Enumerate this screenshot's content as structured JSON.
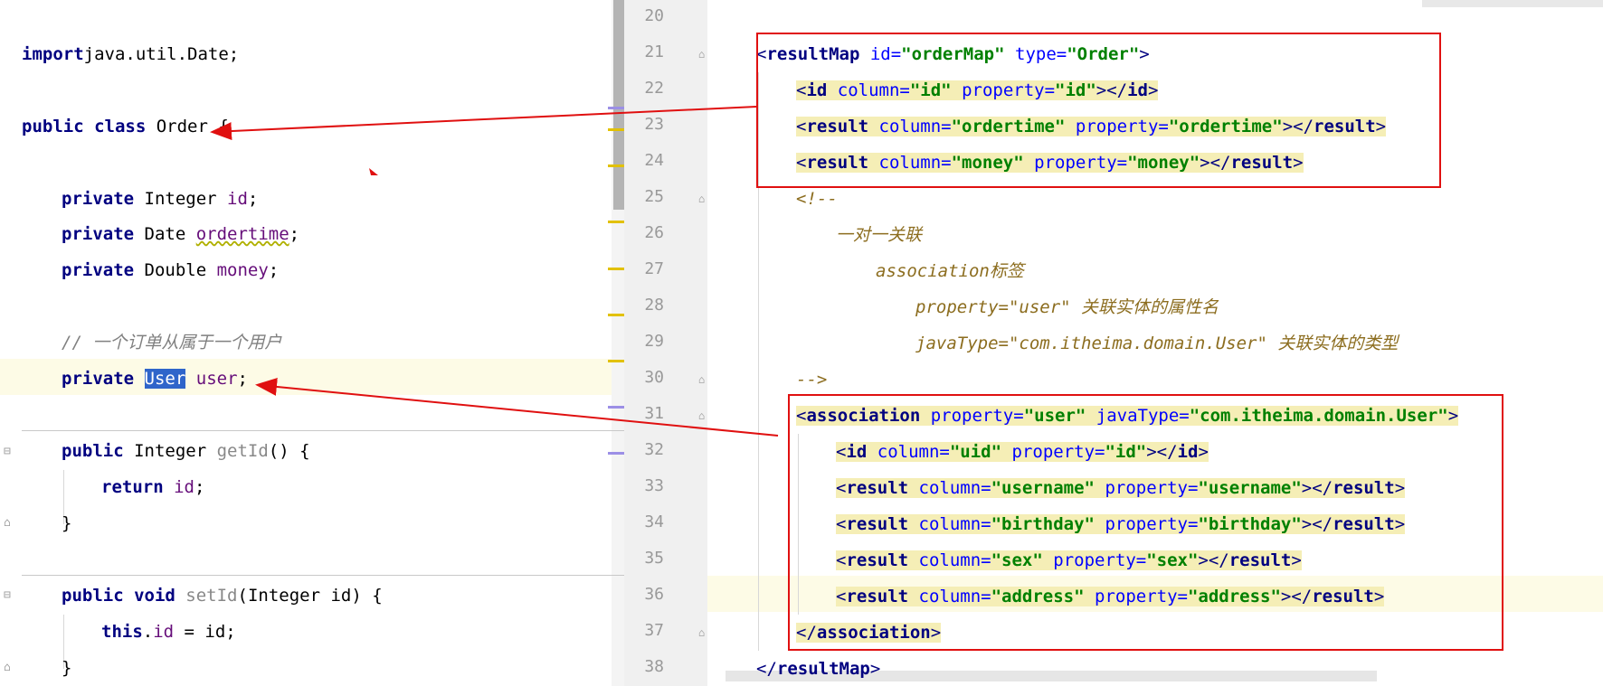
{
  "java_editor": {
    "lines": [
      {
        "parts": [
          [
            "kw",
            "import"
          ],
          [
            "",
            "java.util.Date;"
          ]
        ]
      },
      {
        "parts": [
          [
            "kw",
            "public class"
          ],
          [
            "",
            " Order {"
          ]
        ]
      },
      {
        "parts": [
          [
            "kw",
            "private"
          ],
          [
            "",
            " Integer "
          ],
          [
            "fld",
            "id"
          ],
          [
            "",
            ";"
          ]
        ]
      },
      {
        "parts": [
          [
            "kw",
            "private"
          ],
          [
            "",
            " Date "
          ],
          [
            "fldu",
            "ordertime"
          ],
          [
            "",
            ";"
          ]
        ]
      },
      {
        "parts": [
          [
            "kw",
            "private"
          ],
          [
            "",
            " Double "
          ],
          [
            "fld",
            "money"
          ],
          [
            "",
            ";"
          ]
        ]
      },
      {
        "parts": [
          [
            "cm",
            "// 一个订单从属于一个用户"
          ]
        ]
      },
      {
        "parts": [
          [
            "kw",
            "private"
          ],
          [
            "",
            " "
          ],
          [
            "sel",
            "User"
          ],
          [
            "",
            " "
          ],
          [
            "fld",
            "user"
          ],
          [
            "",
            ";"
          ]
        ]
      },
      {
        "parts": [
          [
            "kw",
            "public"
          ],
          [
            "",
            " Integer "
          ],
          [
            "mth",
            "getId"
          ],
          [
            "",
            "() {"
          ]
        ]
      },
      {
        "parts": [
          [
            "kw",
            "return"
          ],
          [
            "",
            " "
          ],
          [
            "fld",
            "id"
          ],
          [
            "",
            ";"
          ]
        ]
      },
      {
        "parts": [
          [
            "",
            "}"
          ]
        ]
      },
      {
        "parts": [
          [
            "kw",
            "public void"
          ],
          [
            "",
            " "
          ],
          [
            "mth",
            "setId"
          ],
          [
            "",
            "(Integer id) {"
          ]
        ]
      },
      {
        "parts": [
          [
            "kw",
            "this"
          ],
          [
            "",
            "."
          ],
          [
            "fld",
            "id"
          ],
          [
            "",
            " = id;"
          ]
        ]
      },
      {
        "parts": [
          [
            "",
            "}"
          ]
        ]
      }
    ]
  },
  "xml_editor": {
    "line_numbers": [
      "20",
      "21",
      "22",
      "23",
      "24",
      "25",
      "26",
      "27",
      "28",
      "29",
      "30",
      "31",
      "32",
      "33",
      "34",
      "35",
      "36",
      "37",
      "38"
    ],
    "lines": [
      {
        "parts": []
      },
      {
        "parts": [
          [
            "tag",
            "<"
          ],
          [
            "kw2",
            "resultMap"
          ],
          [
            "at",
            " id="
          ],
          [
            "sv",
            "\"orderMap\""
          ],
          [
            "at",
            " type="
          ],
          [
            "sv",
            "\"Order\""
          ],
          [
            "tag",
            ">"
          ]
        ]
      },
      {
        "parts": [
          [
            "tag",
            "<"
          ],
          [
            "kw2",
            "id"
          ],
          [
            "at",
            " column="
          ],
          [
            "sv",
            "\"id\""
          ],
          [
            "at",
            " property="
          ],
          [
            "sv",
            "\"id\""
          ],
          [
            "tag",
            "></"
          ],
          [
            "kw2",
            "id"
          ],
          [
            "tag",
            ">"
          ]
        ]
      },
      {
        "parts": [
          [
            "tag",
            "<"
          ],
          [
            "kw2",
            "result"
          ],
          [
            "at",
            " column="
          ],
          [
            "sv",
            "\"ordertime\""
          ],
          [
            "at",
            " property="
          ],
          [
            "sv",
            "\"ordertime\""
          ],
          [
            "tag",
            "></"
          ],
          [
            "kw2",
            "result"
          ],
          [
            "tag",
            ">"
          ]
        ]
      },
      {
        "parts": [
          [
            "tag",
            "<"
          ],
          [
            "kw2",
            "result"
          ],
          [
            "at",
            " column="
          ],
          [
            "sv",
            "\"money\""
          ],
          [
            "at",
            " property="
          ],
          [
            "sv",
            "\"money\""
          ],
          [
            "tag",
            "></"
          ],
          [
            "kw2",
            "result"
          ],
          [
            "tag",
            ">"
          ]
        ]
      },
      {
        "parts": [
          [
            "cmx",
            "<!--"
          ]
        ]
      },
      {
        "parts": [
          [
            "cmx",
            "一对一关联"
          ]
        ]
      },
      {
        "parts": [
          [
            "cmx",
            "association标签"
          ]
        ]
      },
      {
        "parts": [
          [
            "cmx",
            "property=\"user\" 关联实体的属性名"
          ]
        ]
      },
      {
        "parts": [
          [
            "cmx",
            "javaType=\"com.itheima.domain.User\" 关联实体的类型"
          ]
        ]
      },
      {
        "parts": [
          [
            "cmx",
            "-->"
          ]
        ]
      },
      {
        "parts": [
          [
            "tag",
            "<"
          ],
          [
            "kw2",
            "association"
          ],
          [
            "at",
            " property="
          ],
          [
            "sv",
            "\"user\""
          ],
          [
            "at",
            " javaType="
          ],
          [
            "sv",
            "\"com.itheima.domain.User\""
          ],
          [
            "tag",
            ">"
          ]
        ]
      },
      {
        "parts": [
          [
            "tag",
            "<"
          ],
          [
            "kw2",
            "id"
          ],
          [
            "at",
            " column="
          ],
          [
            "sv",
            "\"uid\""
          ],
          [
            "at",
            " property="
          ],
          [
            "sv",
            "\"id\""
          ],
          [
            "tag",
            "></"
          ],
          [
            "kw2",
            "id"
          ],
          [
            "tag",
            ">"
          ]
        ]
      },
      {
        "parts": [
          [
            "tag",
            "<"
          ],
          [
            "kw2",
            "result"
          ],
          [
            "at",
            " column="
          ],
          [
            "sv",
            "\"username\""
          ],
          [
            "at",
            " property="
          ],
          [
            "sv",
            "\"username\""
          ],
          [
            "tag",
            "></"
          ],
          [
            "kw2",
            "result"
          ],
          [
            "tag",
            ">"
          ]
        ]
      },
      {
        "parts": [
          [
            "tag",
            "<"
          ],
          [
            "kw2",
            "result"
          ],
          [
            "at",
            " column="
          ],
          [
            "sv",
            "\"birthday\""
          ],
          [
            "at",
            " property="
          ],
          [
            "sv",
            "\"birthday\""
          ],
          [
            "tag",
            "></"
          ],
          [
            "kw2",
            "result"
          ],
          [
            "tag",
            ">"
          ]
        ]
      },
      {
        "parts": [
          [
            "tag",
            "<"
          ],
          [
            "kw2",
            "result"
          ],
          [
            "at",
            " column="
          ],
          [
            "sv",
            "\"sex\""
          ],
          [
            "at",
            " property="
          ],
          [
            "sv",
            "\"sex\""
          ],
          [
            "tag",
            "></"
          ],
          [
            "kw2",
            "result"
          ],
          [
            "tag",
            ">"
          ]
        ]
      },
      {
        "parts": [
          [
            "tag",
            "<"
          ],
          [
            "kw2",
            "result"
          ],
          [
            "at",
            " column="
          ],
          [
            "sv",
            "\"address\""
          ],
          [
            "at",
            " property="
          ],
          [
            "sv",
            "\"address\""
          ],
          [
            "tag",
            "></"
          ],
          [
            "kw2",
            "result"
          ],
          [
            "tag",
            ">"
          ]
        ]
      },
      {
        "parts": [
          [
            "tag",
            "</"
          ],
          [
            "kw2",
            "association"
          ],
          [
            "tag",
            ">"
          ]
        ]
      },
      {
        "parts": [
          [
            "tag",
            "</"
          ],
          [
            "kw2",
            "resultMap"
          ],
          [
            "tag",
            ">"
          ]
        ]
      }
    ]
  },
  "colors": {
    "annotation": "#e01010",
    "highlight": "#f5eeb6",
    "selection": "#2f65ca"
  },
  "icons": {
    "fold": "fold-marker-icon",
    "arrow": "annotation-arrow-icon"
  }
}
